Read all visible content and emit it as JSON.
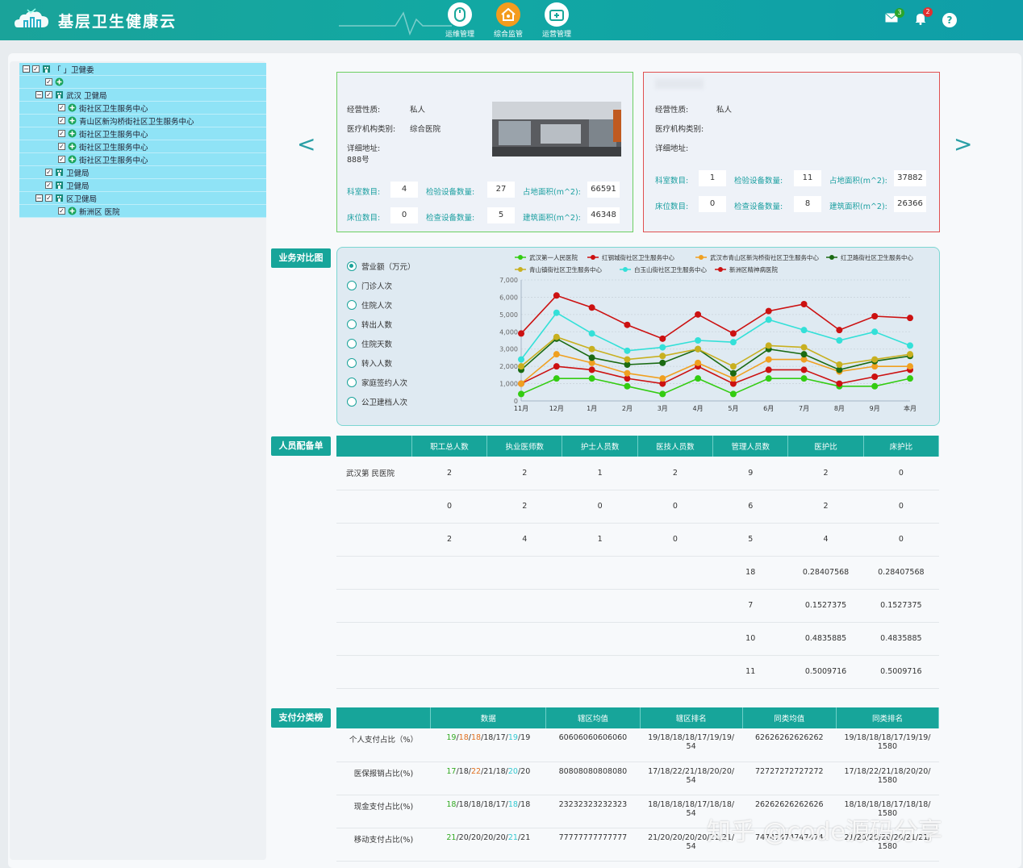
{
  "header": {
    "title": "基层卫生健康云",
    "nav": [
      {
        "label": "运维管理",
        "icon": "mouse-icon",
        "active": false
      },
      {
        "label": "综合监管",
        "icon": "home-icon",
        "active": true
      },
      {
        "label": "运营管理",
        "icon": "hospital-icon",
        "active": false
      }
    ],
    "mail_count": "3",
    "alert_count": "2",
    "help": "?"
  },
  "tree": [
    {
      "level": 0,
      "ctrl": "−",
      "label": "「     」卫健委",
      "icon": "building-icon"
    },
    {
      "level": 1,
      "ctrl": "",
      "label": "",
      "icon": "clinic-icon"
    },
    {
      "level": 1,
      "ctrl": "−",
      "label": "武汉      卫健局",
      "icon": "building-icon"
    },
    {
      "level": 2,
      "ctrl": "",
      "label": "街社区卫生服务中心",
      "icon": "clinic-icon"
    },
    {
      "level": 2,
      "ctrl": "",
      "label": "青山区新沟桥街社区卫生服务中心",
      "icon": "clinic-icon"
    },
    {
      "level": 2,
      "ctrl": "",
      "label": "街社区卫生服务中心",
      "icon": "clinic-icon"
    },
    {
      "level": 2,
      "ctrl": "",
      "label": "街社区卫生服务中心",
      "icon": "clinic-icon"
    },
    {
      "level": 2,
      "ctrl": "",
      "label": "街社区卫生服务中心",
      "icon": "clinic-icon"
    },
    {
      "level": 1,
      "ctrl": "",
      "label": "卫健局",
      "icon": "building-icon"
    },
    {
      "level": 1,
      "ctrl": "",
      "label": "卫健局",
      "icon": "building-icon"
    },
    {
      "level": 1,
      "ctrl": "−",
      "label": "区卫健局",
      "icon": "building-icon"
    },
    {
      "level": 2,
      "ctrl": "",
      "label": "新洲区          医院",
      "icon": "clinic-icon"
    }
  ],
  "cards": {
    "left": {
      "business_nature_label": "经营性质:",
      "business_nature": "私人",
      "category_label": "医疗机构类别:",
      "category": "综合医院",
      "address_label": "详细地址:",
      "address": "888号",
      "dept_label": "科室数目:",
      "dept": "4",
      "inspect_label": "检验设备数量:",
      "inspect": "27",
      "land_label": "占地面积(m^2):",
      "land": "66591",
      "bed_label": "床位数目:",
      "bed": "0",
      "check_label": "检查设备数量:",
      "check": "5",
      "build_label": "建筑面积(m^2):",
      "build": "46348"
    },
    "right": {
      "business_nature_label": "经营性质:",
      "business_nature": "私人",
      "category_label": "医疗机构类别:",
      "address_label": "详细地址:",
      "dept_label": "科室数目:",
      "dept": "1",
      "inspect_label": "检验设备数量:",
      "inspect": "11",
      "land_label": "占地面积(m^2):",
      "land": "37882",
      "bed_label": "床位数目:",
      "bed": "0",
      "check_label": "检查设备数量:",
      "check": "8",
      "build_label": "建筑面积(m^2):",
      "build": "26366"
    },
    "prev": "<",
    "next": ">"
  },
  "sections": {
    "business": "业务对比图",
    "staff": "人员配备单",
    "payment": "支付分类榜"
  },
  "radios": [
    {
      "label": "营业额（万元）",
      "checked": true
    },
    {
      "label": "门诊人次",
      "checked": false
    },
    {
      "label": "住院人次",
      "checked": false
    },
    {
      "label": "转出人数",
      "checked": false
    },
    {
      "label": "住院天数",
      "checked": false
    },
    {
      "label": "转入人数",
      "checked": false
    },
    {
      "label": "家庭签约人次",
      "checked": false
    },
    {
      "label": "公卫建档人次",
      "checked": false
    }
  ],
  "chart_data": {
    "type": "line",
    "categories": [
      "11月",
      "12月",
      "1月",
      "2月",
      "3月",
      "4月",
      "5月",
      "6月",
      "7月",
      "8月",
      "9月",
      "本月"
    ],
    "ylim": [
      0,
      7000
    ],
    "yticks": [
      "0",
      "1,000",
      "2,000",
      "3,000",
      "4,000",
      "5,000",
      "6,000",
      "7,000"
    ],
    "legend_position": "top",
    "grid": true,
    "series": [
      {
        "name": "武汉第一人民医院",
        "color": "#33cc11",
        "values": [
          400,
          1300,
          1300,
          850,
          400,
          1300,
          400,
          1300,
          1300,
          850,
          850,
          1300
        ]
      },
      {
        "name": "红钢城街社区卫生服务中心",
        "color": "#cc1111",
        "values": [
          1000,
          2000,
          1800,
          1300,
          1000,
          2000,
          1000,
          1800,
          1800,
          1000,
          1400,
          1800
        ]
      },
      {
        "name": "武汉市青山区新沟桥街社区卫生服务中心",
        "color": "#f0a020",
        "values": [
          1000,
          2700,
          2200,
          1600,
          1300,
          2200,
          1300,
          2400,
          2400,
          1700,
          2000,
          2000
        ]
      },
      {
        "name": "红卫路街社区卫生服务中心",
        "color": "#1a6a12",
        "values": [
          1800,
          3600,
          2500,
          2100,
          2200,
          3000,
          1600,
          3000,
          2700,
          1800,
          2300,
          2600
        ]
      },
      {
        "name": "青山镇街社区卫生服务中心",
        "color": "#c8b020",
        "values": [
          2000,
          3700,
          3000,
          2400,
          2600,
          3000,
          2000,
          3200,
          3100,
          2100,
          2400,
          2700
        ]
      },
      {
        "name": "白玉山街社区卫生服务中心",
        "color": "#33e0d8",
        "values": [
          2400,
          5100,
          3900,
          2900,
          3100,
          3500,
          3400,
          4700,
          4100,
          3500,
          4000,
          3200
        ]
      },
      {
        "name": "新洲区精神病医院",
        "color": "#cc1111",
        "values": [
          3900,
          6100,
          5400,
          4400,
          3600,
          5000,
          3900,
          5200,
          5600,
          4100,
          4900,
          4800
        ]
      }
    ]
  },
  "staff": {
    "headers": [
      "",
      "职工总人数",
      "执业医师数",
      "护士人员数",
      "医技人员数",
      "管理人员数",
      "医护比",
      "床护比"
    ],
    "rows": [
      [
        "武汉第   民医院",
        "2",
        "2",
        "1",
        "2",
        "9",
        "2",
        "0"
      ],
      [
        "",
        "0",
        "2",
        "0",
        "0",
        "6",
        "2",
        "0"
      ],
      [
        "",
        "2",
        "4",
        "1",
        "0",
        "5",
        "4",
        "0"
      ],
      [
        "",
        "",
        "",
        "",
        "",
        "18",
        "0.28407568",
        "0.28407568"
      ],
      [
        "",
        "",
        "",
        "",
        "",
        "7",
        "0.1527375",
        "0.1527375"
      ],
      [
        "",
        "",
        "",
        "",
        "",
        "10",
        "0.4835885",
        "0.4835885"
      ],
      [
        "",
        "",
        "",
        "",
        "",
        "11",
        "0.5009716",
        "0.5009716"
      ]
    ]
  },
  "payment": {
    "headers": [
      "",
      "数据",
      "辖区均值",
      "辖区排名",
      "同类均值",
      "同类排名"
    ],
    "rows": [
      {
        "label": "个人支付占比（%）",
        "data": [
          [
            "19",
            "#33aa22"
          ],
          [
            "18",
            "#e07020"
          ],
          [
            "18",
            "#e07020"
          ],
          [
            "18",
            "#333"
          ],
          [
            "17",
            "#333"
          ],
          [
            "19",
            "#33c8d0"
          ],
          [
            "19",
            "#333"
          ]
        ],
        "mean": "60606060606060",
        "rank": "19/18/18/18/17/19/19/ 54",
        "cmean": "62626262626262",
        "crank": "19/18/18/18/17/19/19/ 1580"
      },
      {
        "label": "医保报销占比(%)",
        "data": [
          [
            "17",
            "#33aa22"
          ],
          [
            "18",
            "#333"
          ],
          [
            "22",
            "#e07020"
          ],
          [
            "21",
            "#333"
          ],
          [
            "18",
            "#333"
          ],
          [
            "20",
            "#33c8d0"
          ],
          [
            "20",
            "#333"
          ]
        ],
        "mean": "80808080808080",
        "rank": "17/18/22/21/18/20/20/ 54",
        "cmean": "72727272727272",
        "crank": "17/18/22/21/18/20/20/ 1580"
      },
      {
        "label": "现金支付占比(%)",
        "data": [
          [
            "18",
            "#33aa22"
          ],
          [
            "18",
            "#333"
          ],
          [
            "18",
            "#333"
          ],
          [
            "18",
            "#333"
          ],
          [
            "17",
            "#333"
          ],
          [
            "18",
            "#33c8d0"
          ],
          [
            "18",
            "#333"
          ]
        ],
        "mean": "23232323232323",
        "rank": "18/18/18/18/17/18/18/ 54",
        "cmean": "26262626262626",
        "crank": "18/18/18/18/17/18/18/ 1580"
      },
      {
        "label": "移动支付占比(%)",
        "data": [
          [
            "21",
            "#33aa22"
          ],
          [
            "20",
            "#333"
          ],
          [
            "20",
            "#333"
          ],
          [
            "20",
            "#333"
          ],
          [
            "20",
            "#333"
          ],
          [
            "21",
            "#33c8d0"
          ],
          [
            "21",
            "#333"
          ]
        ],
        "mean": "77777777777777",
        "rank": "21/20/20/20/20/21/21/ 54",
        "cmean": "74747474747474",
        "crank": "21/20/20/20/20/21/21/ 1580"
      }
    ]
  },
  "watermark": "知乎 @code源码分享"
}
